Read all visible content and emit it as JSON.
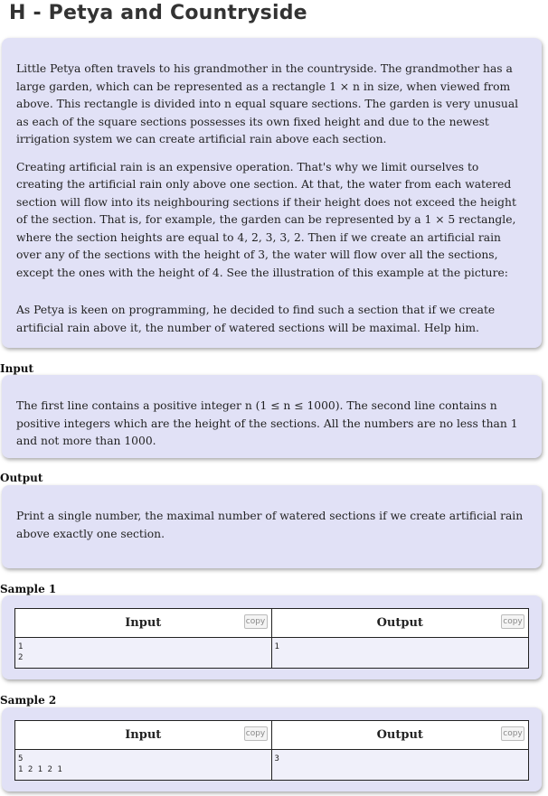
{
  "title": "H - Petya and Countryside",
  "statement": {
    "paragraphs": [
      "Little Petya often travels to his grandmother in the countryside. The grandmother has a large garden, which can be represented as a rectangle 1 × n in size, when viewed from above. This rectangle is divided into n equal square sections. The garden is very unusual as each of the square sections possesses its own fixed height and due to the newest irrigation system we can create artificial rain above each section.",
      "Creating artificial rain is an expensive operation. That's why we limit ourselves to creating the artificial rain only above one section. At that, the water from each watered section will flow into its neighbouring sections if their height does not exceed the height of the section. That is, for example, the garden can be represented by a 1 × 5 rectangle, where the section heights are equal to 4, 2, 3, 3, 2. Then if we create an artificial rain over any of the sections with the height of 3, the water will flow over all the sections, except the ones with the height of 4. See the illustration of this example at the picture:",
      "As Petya is keen on programming, he decided to find such a section that if we create artificial rain above it, the number of watered sections will be maximal. Help him."
    ]
  },
  "input": {
    "label": "Input",
    "text": "The first line contains a positive integer n (1 ≤ n ≤ 1000). The second line contains n positive integers which are the height of the sections. All the numbers are no less than 1 and not more than 1000."
  },
  "output": {
    "label": "Output",
    "text": "Print a single number, the maximal number of watered sections if we create artificial rain above exactly one section."
  },
  "samples": [
    {
      "label": "Sample 1",
      "input_header": "Input",
      "output_header": "Output",
      "copy_label": "copy",
      "input": "1\n2",
      "output": "1"
    },
    {
      "label": "Sample 2",
      "input_header": "Input",
      "output_header": "Output",
      "copy_label": "copy",
      "input": "5\n1 2 1 2 1",
      "output": "3"
    }
  ]
}
